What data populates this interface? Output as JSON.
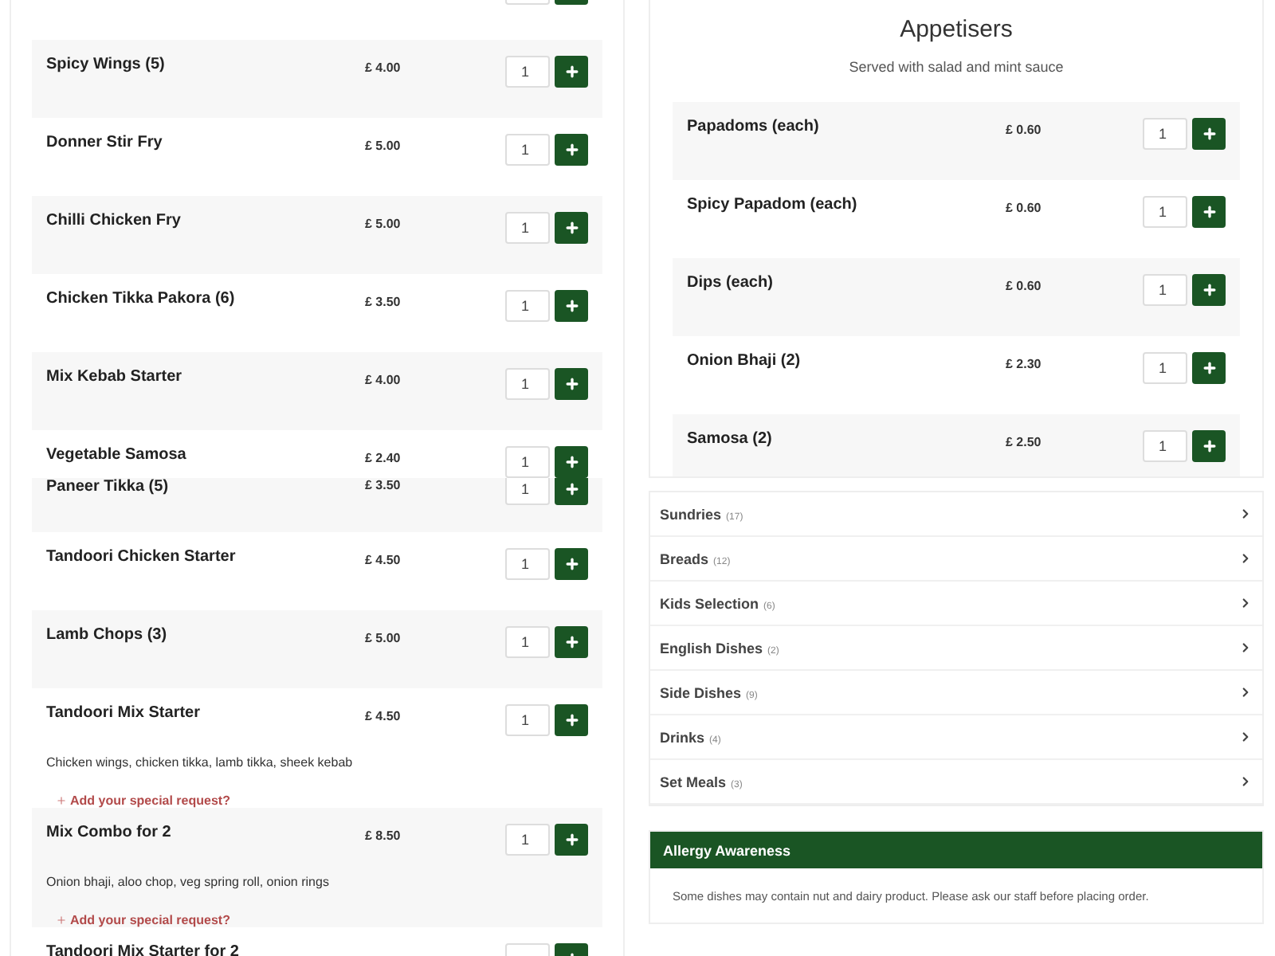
{
  "left_menu": {
    "items": [
      {
        "kind": "stub"
      },
      {
        "kind": "item",
        "name": "Spicy Wings (5)",
        "price": "£ 4.00",
        "quantity": "1"
      },
      {
        "kind": "item",
        "name": "Donner Stir Fry",
        "price": "£ 5.00",
        "quantity": "1"
      },
      {
        "kind": "item",
        "name": "Chilli Chicken Fry",
        "price": "£ 5.00",
        "quantity": "1"
      },
      {
        "kind": "item",
        "name": "Chicken Tikka Pakora (6)",
        "price": "£ 3.50",
        "quantity": "1"
      },
      {
        "kind": "item",
        "name": "Mix Kebab Starter",
        "price": "£ 4.00",
        "quantity": "1"
      },
      {
        "kind": "short",
        "name": "Vegetable Samosa",
        "price": "£ 2.40",
        "quantity": "1"
      },
      {
        "kind": "short",
        "name": "Paneer Tikka (5)",
        "price": "£ 3.50",
        "quantity": "1"
      },
      {
        "kind": "item",
        "name": "Tandoori Chicken Starter",
        "price": "£ 4.50",
        "quantity": "1"
      },
      {
        "kind": "item",
        "name": "Lamb Chops (3)",
        "price": "£ 5.00",
        "quantity": "1"
      },
      {
        "kind": "item",
        "name": "Tandoori Mix Starter",
        "price": "£ 4.50",
        "quantity": "1",
        "description": "Chicken wings, chicken tikka, lamb tikka, sheek kebab",
        "request_link": "Add your special request?"
      },
      {
        "kind": "item",
        "name": "Mix Combo for 2",
        "price": "£ 8.50",
        "quantity": "1",
        "description": "Onion bhaji, aloo chop, veg spring roll, onion rings",
        "request_link": "Add your special request?"
      },
      {
        "kind": "item",
        "name": "Tandoori Mix Starter for 2"
      }
    ]
  },
  "appetisers": {
    "title": "Appetisers",
    "subtitle": "Served with salad and mint sauce",
    "items": [
      {
        "name": "Papadoms (each)",
        "price": "£ 0.60",
        "quantity": "1"
      },
      {
        "name": "Spicy Papadom (each)",
        "price": "£ 0.60",
        "quantity": "1"
      },
      {
        "name": "Dips (each)",
        "price": "£ 0.60",
        "quantity": "1"
      },
      {
        "name": "Onion Bhaji (2)",
        "price": "£ 2.30",
        "quantity": "1"
      },
      {
        "name": "Samosa (2)",
        "price": "£ 2.50",
        "quantity": "1"
      }
    ]
  },
  "categories": [
    {
      "name": "Sundries",
      "count": "(17)"
    },
    {
      "name": "Breads",
      "count": "(12)"
    },
    {
      "name": "Kids Selection",
      "count": "(6)"
    },
    {
      "name": "English Dishes",
      "count": "(2)"
    },
    {
      "name": "Side Dishes",
      "count": "(9)"
    },
    {
      "name": "Drinks",
      "count": "(4)"
    },
    {
      "name": "Set Meals",
      "count": "(3)"
    }
  ],
  "allergy": {
    "title": "Allergy Awareness",
    "text": "Some dishes may contain nut and dairy product. Please ask our staff before placing order."
  }
}
